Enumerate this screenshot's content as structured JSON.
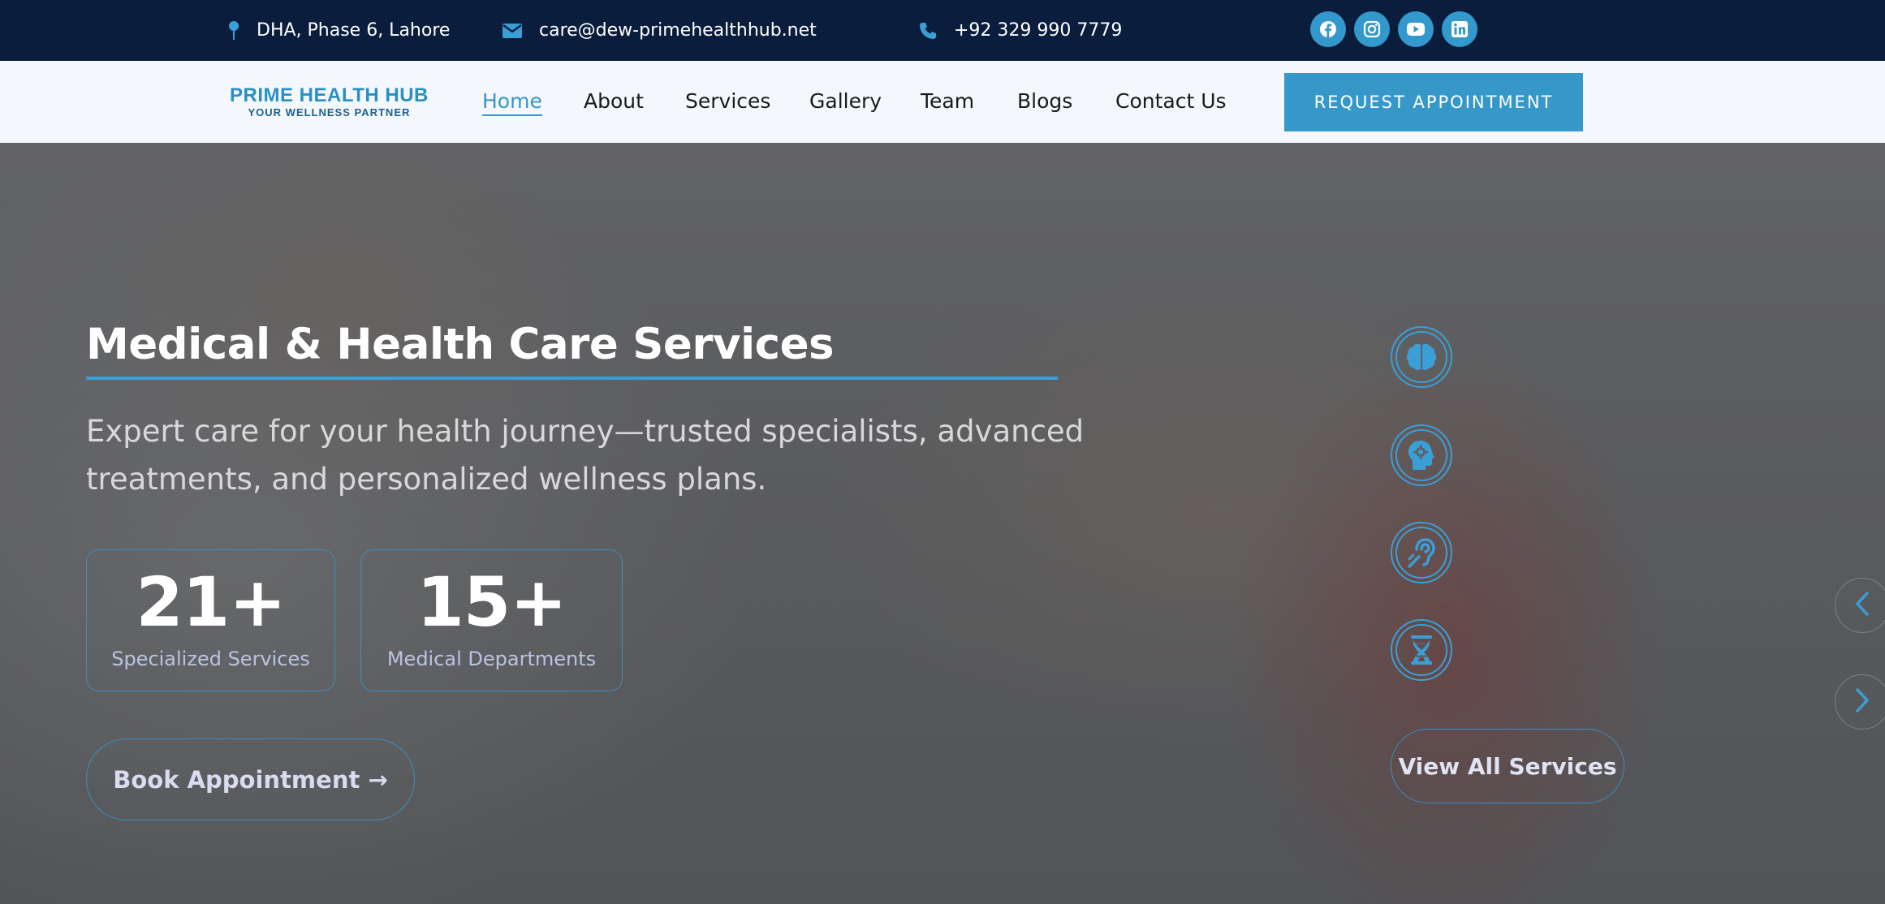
{
  "topbar": {
    "address": "DHA, Phase 6, Lahore",
    "email": "care@dew-primehealthhub.net",
    "phone": "+92 329 990 7779",
    "socials": [
      "facebook-icon",
      "instagram-icon",
      "youtube-icon",
      "linkedin-icon"
    ]
  },
  "logo": {
    "title": "PRIME HEALTH HUB",
    "tagline": "YOUR WELLNESS PARTNER"
  },
  "nav": {
    "items": [
      {
        "label": "Home",
        "active": true
      },
      {
        "label": "About"
      },
      {
        "label": "Services"
      },
      {
        "label": "Gallery"
      },
      {
        "label": "Team"
      },
      {
        "label": "Blogs"
      },
      {
        "label": "Contact Us"
      }
    ],
    "cta": "REQUEST APPOINTMENT"
  },
  "hero": {
    "title": "Medical & Health Care Services",
    "subtitle": "Expert care for your health journey—trusted specialists, advanced treatments, and personalized wellness plans.",
    "stats": [
      {
        "value": "21+",
        "label": "Specialized Services"
      },
      {
        "value": "15+",
        "label": "Medical Departments"
      }
    ],
    "book_button": "Book Appointment →",
    "service_icons": [
      "brain-icon",
      "head-gear-icon",
      "ear-icon",
      "dna-icon"
    ],
    "view_all": "View All Services"
  },
  "slider": {
    "prev": "chevron-left-icon",
    "next": "chevron-right-icon"
  },
  "colors": {
    "topbar_bg": "#0b1d3d",
    "accent": "#3598c9",
    "navbar_bg": "#f4f8fc"
  }
}
